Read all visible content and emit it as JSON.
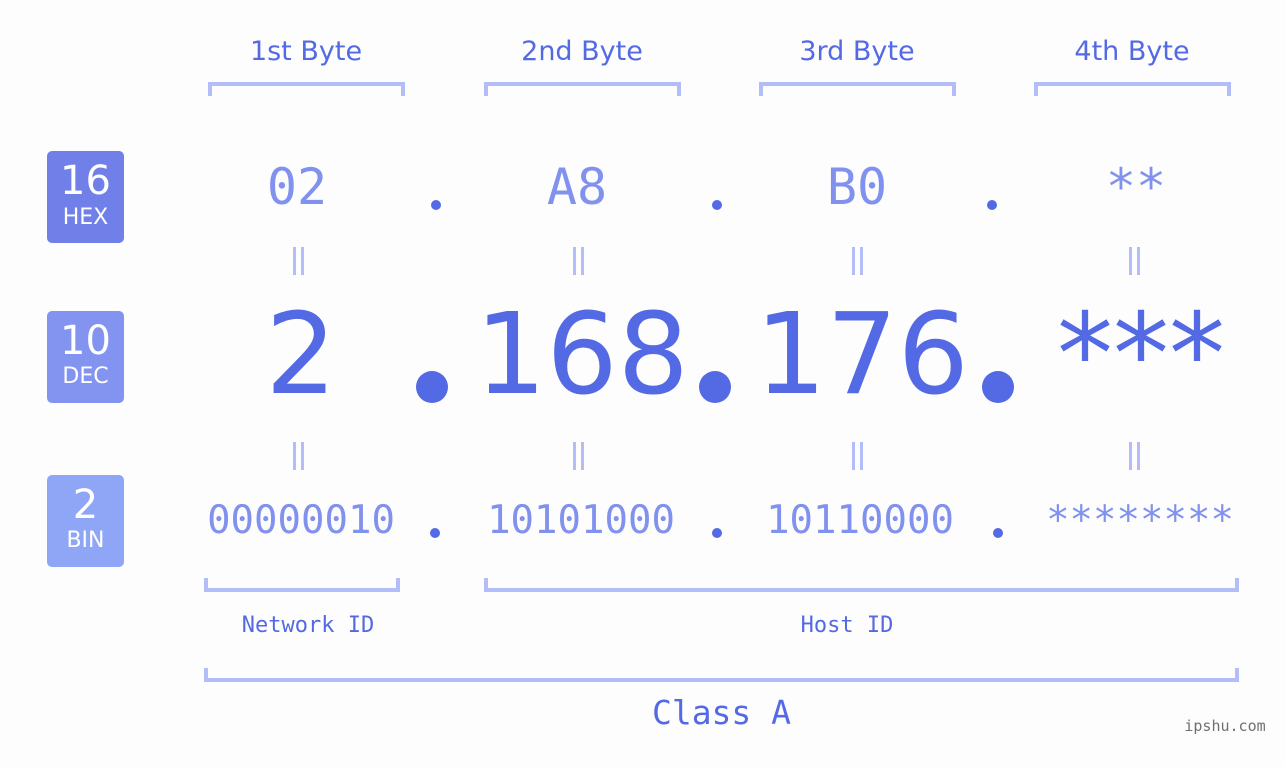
{
  "badges": {
    "hex": {
      "num": "16",
      "label": "HEX",
      "color": "#7080e8"
    },
    "dec": {
      "num": "10",
      "label": "DEC",
      "color": "#8394f0"
    },
    "bin": {
      "num": "2",
      "label": "BIN",
      "color": "#8fa6f6"
    }
  },
  "bytes": [
    {
      "header": "1st Byte",
      "hex": "02",
      "dec": "2",
      "bin": "00000010"
    },
    {
      "header": "2nd Byte",
      "hex": "A8",
      "dec": "168",
      "bin": "10101000"
    },
    {
      "header": "3rd Byte",
      "hex": "B0",
      "dec": "176",
      "bin": "10110000"
    },
    {
      "header": "4th Byte",
      "hex": "**",
      "dec": "***",
      "bin": "********"
    }
  ],
  "network_label": "Network ID",
  "host_label": "Host ID",
  "class_label": "Class A",
  "watermark": "ipshu.com",
  "colors": {
    "accent": "#5469e4",
    "light": "#8191ee",
    "bracket": "#b3bdf8"
  }
}
